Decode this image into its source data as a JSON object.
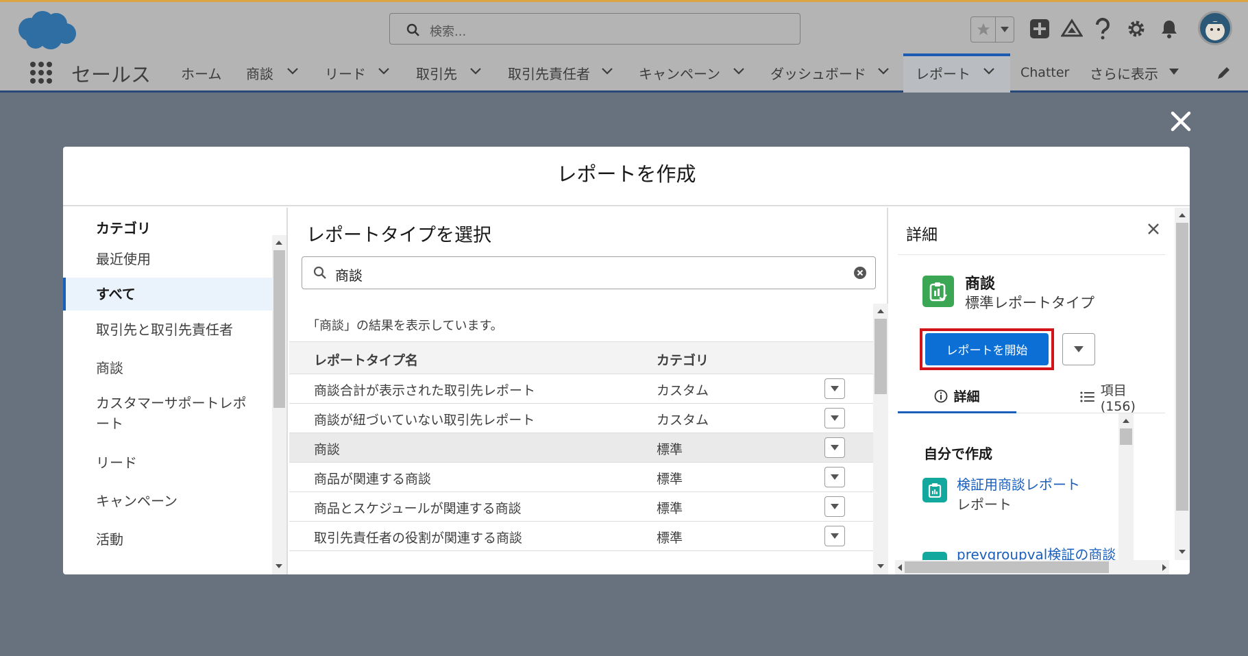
{
  "header": {
    "search_placeholder": "検索...",
    "icons": [
      "star-icon",
      "add-icon",
      "trailhead-icon",
      "help-icon",
      "gear-icon",
      "bell-icon",
      "avatar"
    ]
  },
  "nav": {
    "app_name": "セールス",
    "items": [
      {
        "label": "ホーム",
        "chevron": false
      },
      {
        "label": "商談",
        "chevron": true
      },
      {
        "label": "リード",
        "chevron": true
      },
      {
        "label": "取引先",
        "chevron": true
      },
      {
        "label": "取引先責任者",
        "chevron": true
      },
      {
        "label": "キャンペーン",
        "chevron": true
      },
      {
        "label": "ダッシュボード",
        "chevron": true
      },
      {
        "label": "レポート",
        "chevron": true,
        "active": true
      },
      {
        "label": "Chatter",
        "chevron": false
      },
      {
        "label": "さらに表示",
        "chevron": true
      }
    ]
  },
  "modal": {
    "title": "レポートを作成",
    "categories": {
      "heading": "カテゴリ",
      "items": [
        "最近使用",
        "すべて",
        "取引先と取引先責任者",
        "商談",
        "カスタマーサポートレポ\nート",
        "リード",
        "キャンペーン",
        "活動"
      ],
      "selected_index": 1
    },
    "report_types": {
      "heading": "レポートタイプを選択",
      "search_value": "商談",
      "result_text": "「商談」の結果を表示しています。",
      "columns": [
        "レポートタイプ名",
        "カテゴリ"
      ],
      "rows": [
        {
          "name": "商談合計が表示された取引先レポート",
          "category": "カスタム"
        },
        {
          "name": "商談が紐づいていない取引先レポート",
          "category": "カスタム"
        },
        {
          "name": "商談",
          "category": "標準",
          "highlighted": true
        },
        {
          "name": "商品が関連する商談",
          "category": "標準"
        },
        {
          "name": "商品とスケジュールが関連する商談",
          "category": "標準"
        },
        {
          "name": "取引先責任者の役割が関連する商談",
          "category": "標準"
        }
      ]
    },
    "details": {
      "heading": "詳細",
      "object_name": "商談",
      "object_type": "標準レポートタイプ",
      "start_button": "レポートを開始",
      "tab_details": "詳細",
      "tab_fields": "項目 (156)",
      "section_title": "自分で作成",
      "reports": [
        {
          "name": "検証用商談レポート",
          "type": "レポート"
        },
        {
          "name": "prevgroupval検証の商談",
          "type": ""
        }
      ]
    }
  }
}
